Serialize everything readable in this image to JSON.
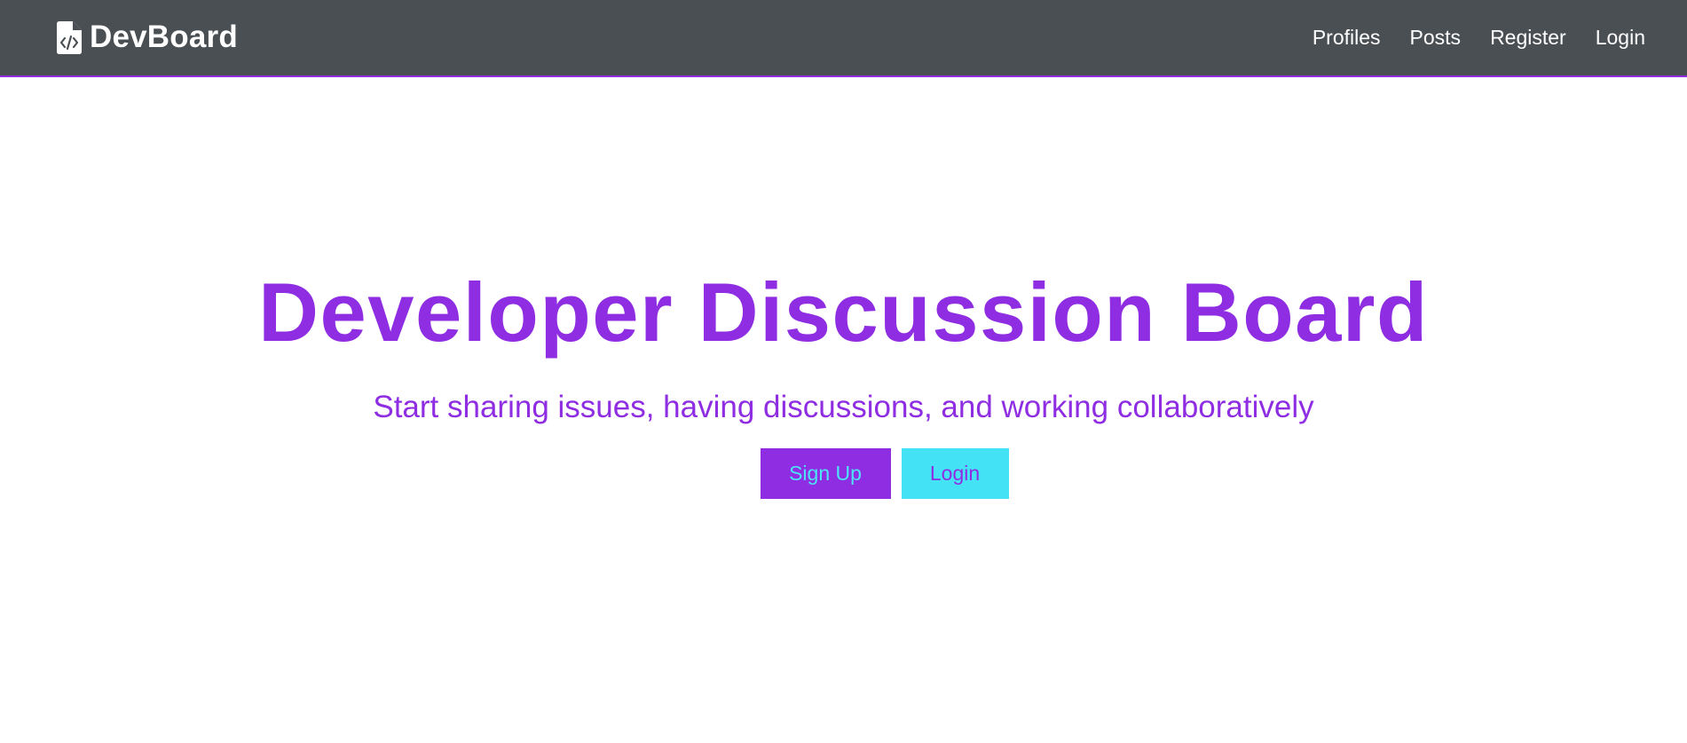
{
  "navbar": {
    "brand": {
      "icon": "file-code-icon",
      "label": "DevBoard"
    },
    "links": [
      {
        "label": "Profiles"
      },
      {
        "label": "Posts"
      },
      {
        "label": "Register"
      },
      {
        "label": "Login"
      }
    ]
  },
  "hero": {
    "title": "Developer Discussion Board",
    "subtitle": "Start sharing issues, having discussions, and working collaboratively",
    "buttons": {
      "signup_label": "Sign Up",
      "login_label": "Login"
    }
  },
  "colors": {
    "navbar_bg": "#4a4f54",
    "primary": "#8e2de2",
    "secondary": "#44e2f5",
    "nav_text": "#ffffff"
  }
}
